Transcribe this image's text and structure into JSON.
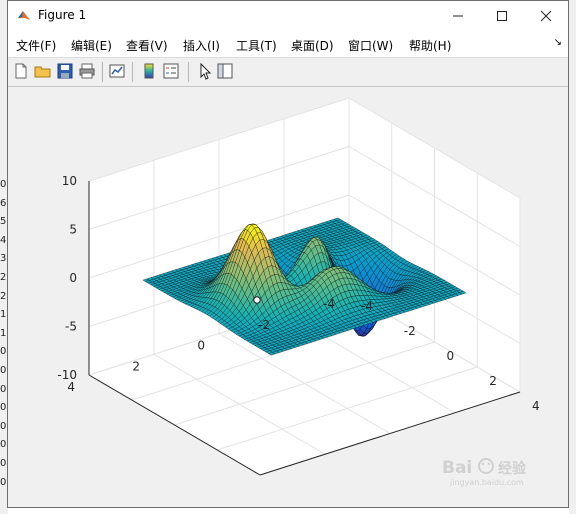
{
  "window": {
    "title": "Figure 1"
  },
  "menu": [
    {
      "label": "文件(F)"
    },
    {
      "label": "编辑(E)"
    },
    {
      "label": "查看(V)"
    },
    {
      "label": "插入(I)"
    },
    {
      "label": "工具(T)"
    },
    {
      "label": "桌面(D)"
    },
    {
      "label": "窗口(W)"
    },
    {
      "label": "帮助(H)"
    }
  ],
  "toolbar": {
    "icons": [
      "new-figure-icon",
      "open-file-icon",
      "save-icon",
      "print-icon",
      "link-plot-icon",
      "insert-colorbar-icon",
      "insert-legend-icon",
      "edit-plot-icon",
      "property-inspector-icon"
    ]
  },
  "chart_data": {
    "type": "surface",
    "function": "peaks",
    "colormap": "parula",
    "grid": true,
    "x": [
      -3,
      -1.5,
      0,
      1.5,
      3
    ],
    "y": [
      -3,
      -1.5,
      0,
      1.5,
      3
    ],
    "z_range": [
      -6.5,
      8.1
    ],
    "xlim": [
      -4,
      4
    ],
    "ylim": [
      -4,
      4
    ],
    "zlim": [
      -10,
      10
    ],
    "xticks": [
      "-4",
      "-2",
      "0",
      "2",
      "4"
    ],
    "yticks": [
      "4",
      "2",
      "0",
      "-2",
      "-4"
    ],
    "zticks": [
      "10",
      "5",
      "0",
      "-5",
      "-10"
    ],
    "peak_max": 8.1,
    "peak_min": -6.5
  },
  "background_window_fragments": {
    "left_numbers": [
      "0",
      "6",
      "5",
      "4",
      "3",
      "2",
      "2",
      "1",
      "1",
      "0",
      "0",
      "0",
      "0",
      "0",
      "0",
      "0",
      "0"
    ]
  }
}
